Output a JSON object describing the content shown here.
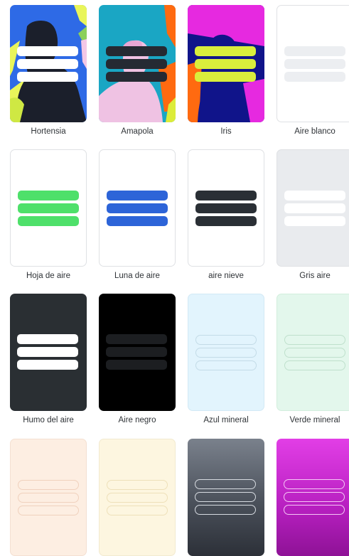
{
  "themes": [
    {
      "label": "Hortensia"
    },
    {
      "label": "Amapola"
    },
    {
      "label": "Iris"
    },
    {
      "label": "Aire blanco"
    },
    {
      "label": "Hoja de aire"
    },
    {
      "label": "Luna de aire"
    },
    {
      "label": "aire nieve"
    },
    {
      "label": "Gris aire"
    },
    {
      "label": "Humo del aire"
    },
    {
      "label": "Aire negro"
    },
    {
      "label": "Azul mineral"
    },
    {
      "label": "Verde mineral"
    },
    {
      "label": ""
    },
    {
      "label": ""
    },
    {
      "label": ""
    },
    {
      "label": ""
    }
  ],
  "colors": {
    "hortensia_bg": "#2e6ae6",
    "amapola_bg": "#1aa6c4",
    "iris_bg": "#10148a",
    "hoja_bars": "#4ee06a",
    "luna_bars": "#2d64d8",
    "nieve_bars": "#2a2f35",
    "humo_bg": "#2a2f33",
    "negro_bg": "#000000",
    "azul_mineral_bg": "#e2f4fd",
    "verde_mineral_bg": "#e3f7ec"
  }
}
